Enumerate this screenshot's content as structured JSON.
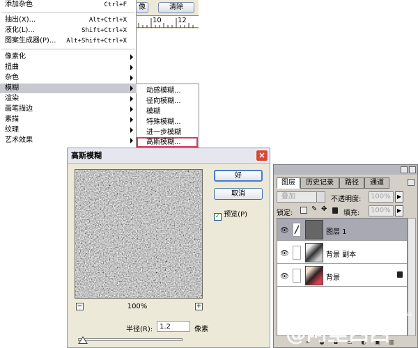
{
  "toolbar": {
    "btn_partial": "像",
    "clear_label": "清除",
    "ruler_ticks": [
      "10",
      "12"
    ]
  },
  "menu": {
    "items": [
      {
        "label": "添加杂色",
        "shortcut": "Ctrl+F"
      },
      {
        "label": "抽出(X)...",
        "shortcut": "Alt+Ctrl+X"
      },
      {
        "label": "液化(L)...",
        "shortcut": "Shift+Ctrl+X"
      },
      {
        "label": "图案生成器(P)...",
        "shortcut": "Alt+Shift+Ctrl+X"
      },
      {
        "label": "像素化"
      },
      {
        "label": "扭曲"
      },
      {
        "label": "杂色"
      },
      {
        "label": "模糊"
      },
      {
        "label": "渲染"
      },
      {
        "label": "画笔描边"
      },
      {
        "label": "素描"
      },
      {
        "label": "纹理"
      },
      {
        "label": "艺术效果"
      }
    ]
  },
  "submenu": {
    "items": [
      "动感模糊...",
      "径向模糊...",
      "模糊",
      "特殊模糊...",
      "进一步模糊",
      "高斯模糊..."
    ]
  },
  "dialog": {
    "title": "高斯模糊",
    "close": "×",
    "ok_label": "好",
    "cancel_label": "取消",
    "preview_label": "预览(P)",
    "preview_checked": "✓",
    "zoom_minus": "−",
    "zoom_plus": "+",
    "zoom": "100%",
    "radius_label": "半径(R):",
    "radius_value": "1.2",
    "radius_unit": "像素"
  },
  "layers": {
    "tabs": [
      "图层",
      "历史记录",
      "路径",
      "通道"
    ],
    "blend_mode": "叠加",
    "opacity_label": "不透明度:",
    "opacity_value": "100%",
    "lock_label": "锁定:",
    "fill_label": "填充:",
    "fill_value": "100%",
    "items": [
      {
        "name": "图层 1"
      },
      {
        "name": "背景 副本"
      },
      {
        "name": "背景"
      }
    ]
  },
  "watermark": {
    "text": "@阿里西西",
    "small": "WEB"
  }
}
